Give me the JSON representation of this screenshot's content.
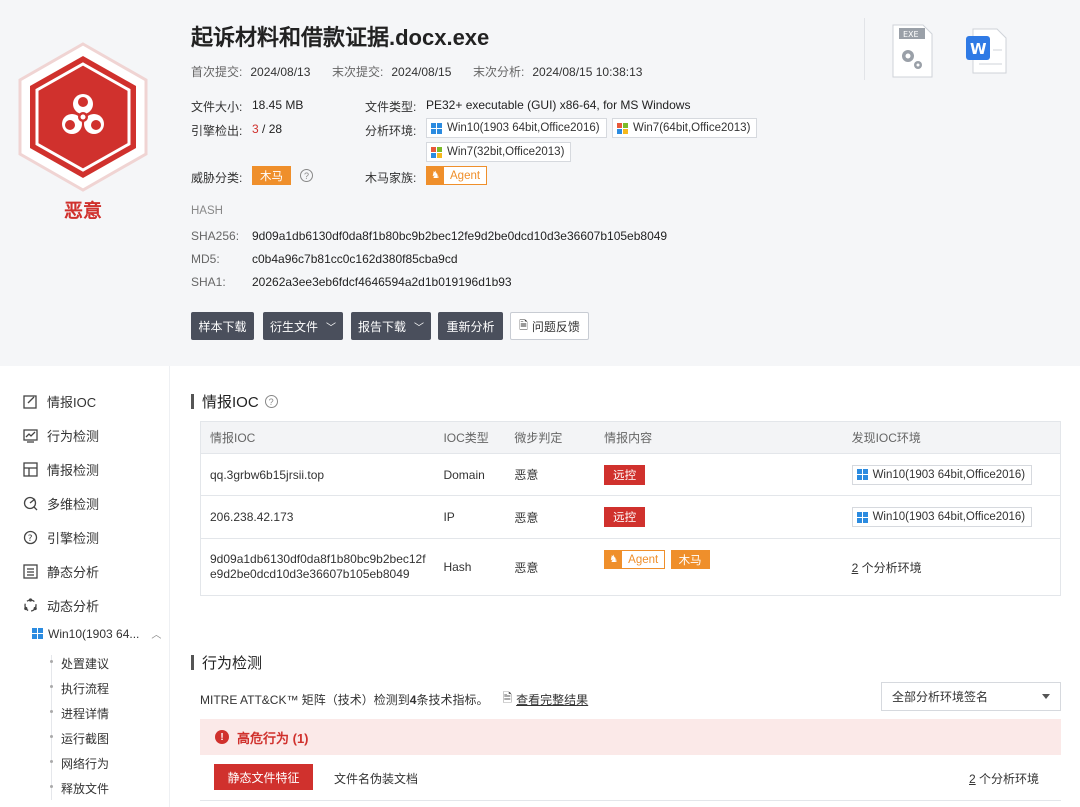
{
  "header": {
    "file_name": "起诉材料和借款证据.docx.exe",
    "verdict": "恶意",
    "first_submit_label": "首次提交:",
    "first_submit": "2024/08/13",
    "last_submit_label": "末次提交:",
    "last_submit": "2024/08/15",
    "last_analysis_label": "末次分析:",
    "last_analysis": "2024/08/15 10:38:13",
    "file_size_label": "文件大小:",
    "file_size": "18.45 MB",
    "file_type_label": "文件类型:",
    "file_type": "PE32+ executable (GUI) x86-64, for MS Windows",
    "engine_label": "引擎检出:",
    "engine_hits": "3",
    "engine_total": "/ 28",
    "env_label": "分析环境:",
    "envs": [
      "Win10(1903 64bit,Office2016)",
      "Win7(64bit,Office2013)",
      "Win7(32bit,Office2013)"
    ],
    "threat_label": "威胁分类:",
    "threat_tag": "木马",
    "family_label": "木马家族:",
    "family_tag": "Agent",
    "hash_title": "HASH",
    "sha256_label": "SHA256:",
    "sha256": "9d09a1db6130df0da8f1b80bc9b2bec12fe9d2be0dcd10d3e36607b105eb8049",
    "md5_label": "MD5:",
    "md5": "c0b4a96c7b81cc0c162d380f85cba9cd",
    "sha1_label": "SHA1:",
    "sha1": "20262a3ee3eb6fdcf4646594a2d1b019196d1b93",
    "exe_icon_text": "EXE"
  },
  "actions": {
    "download_sample": "样本下载",
    "derived_files": "衍生文件",
    "report_download": "报告下载",
    "reanalyze": "重新分析",
    "feedback": "问题反馈"
  },
  "sidebar": {
    "items": [
      "情报IOC",
      "行为检测",
      "情报检测",
      "多维检测",
      "引擎检测",
      "静态分析",
      "动态分析"
    ],
    "env": "Win10(1903 64...",
    "sub_items": [
      "处置建议",
      "执行流程",
      "进程详情",
      "运行截图",
      "网络行为",
      "释放文件"
    ]
  },
  "ioc": {
    "title": "情报IOC",
    "columns": [
      "情报IOC",
      "IOC类型",
      "微步判定",
      "情报内容",
      "发现IOC环境"
    ],
    "rows": [
      {
        "ioc": "qq.3grbw6b15jrsii.top",
        "type": "Domain",
        "verdict": "恶意",
        "tag": "远控",
        "env": "Win10(1903 64bit,Office2016)"
      },
      {
        "ioc": "206.238.42.173",
        "type": "IP",
        "verdict": "恶意",
        "tag": "远控",
        "env": "Win10(1903 64bit,Office2016)"
      },
      {
        "ioc_line1": "9d09a1db6130df0da8f1b80bc9b2bec12f",
        "ioc_line2": "e9d2be0dcd10d3e36607b105eb8049",
        "type": "Hash",
        "verdict": "恶意",
        "tag1": "Agent",
        "tag2": "木马",
        "env_count": "2",
        "env_suffix": " 个分析环境"
      }
    ]
  },
  "behavior": {
    "title": "行为检测",
    "mitre_prefix": "MITRE ATT&CK™ 矩阵（技术）检测到",
    "mitre_count": "4",
    "mitre_suffix": " 条技术指标。",
    "full_results": "查看完整结果",
    "select_value": "全部分析环境签名",
    "risk_label": "高危行为 (1)",
    "rule_tag": "静态文件特征",
    "rule_desc": "文件名伪装文档",
    "env_count": "2",
    "env_suffix": " 个分析环境"
  }
}
